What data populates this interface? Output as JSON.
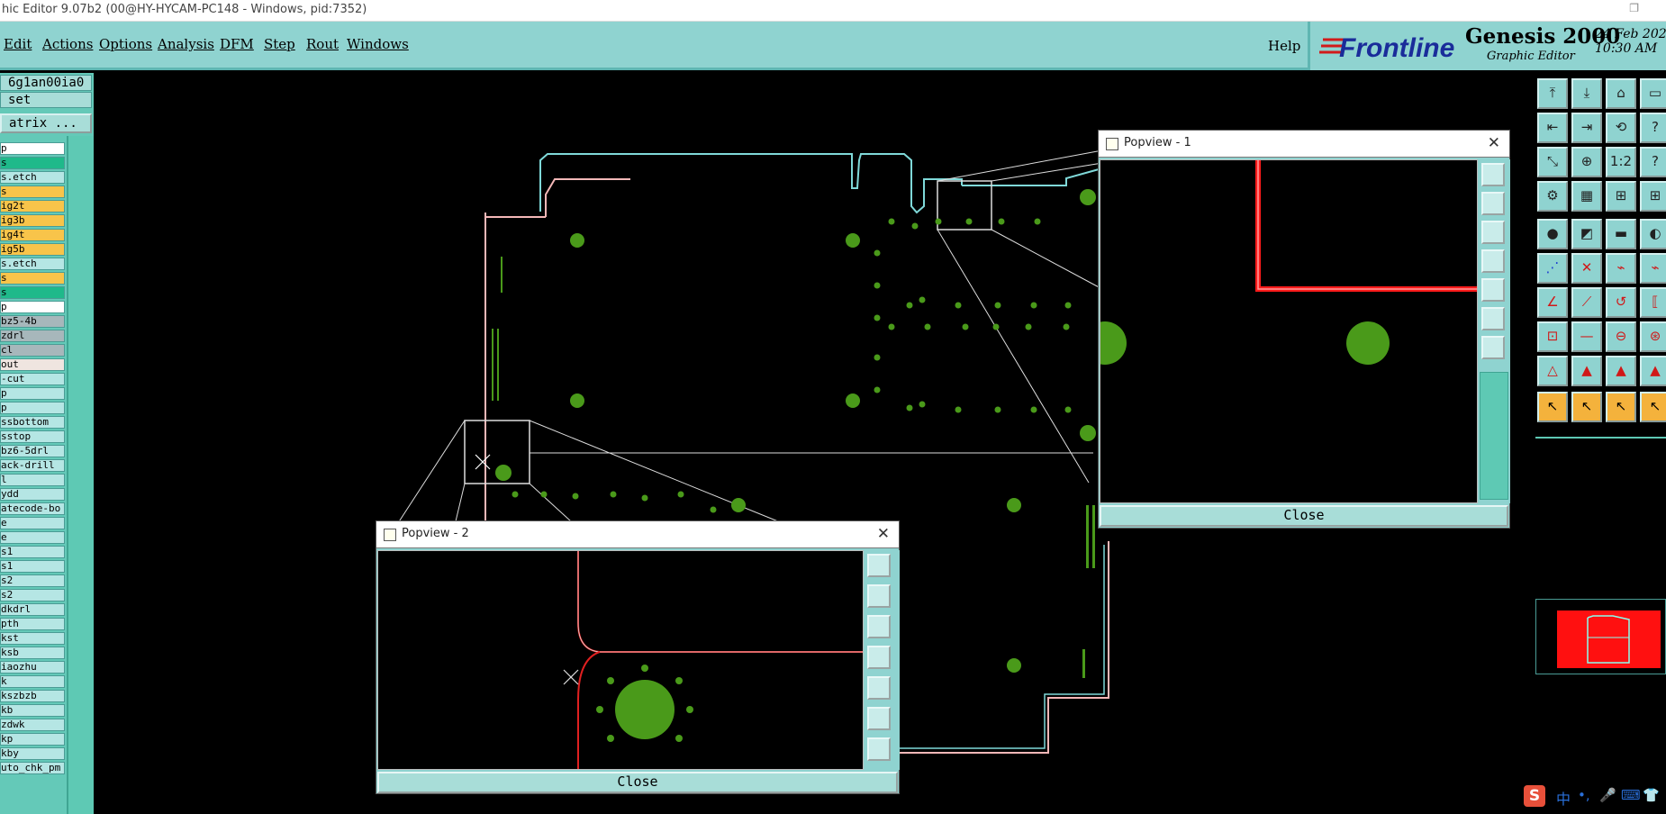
{
  "window": {
    "title": "hic Editor 9.07b2 (00@HY-HYCAM-PC148 - Windows, pid:7352)"
  },
  "menu": {
    "items": [
      {
        "label": "Edit"
      },
      {
        "label": "Actions"
      },
      {
        "label": "Options"
      },
      {
        "label": "Analysis"
      },
      {
        "label": "DFM"
      },
      {
        "label": "Step"
      },
      {
        "label": "Rout"
      },
      {
        "label": "Windows"
      }
    ],
    "help": "Help"
  },
  "brand": {
    "logo_text": "Frontline",
    "product": "Genesis 2000",
    "subtitle": "Graphic Editor",
    "date": "24 Feb 202",
    "time": "10:30 AM"
  },
  "left_panel": {
    "job": "6g1an00ia0",
    "step": "set",
    "matrix_button": "atrix ...",
    "layers": [
      {
        "label": "p",
        "color": "white"
      },
      {
        "label": "s",
        "color": "green"
      },
      {
        "label": "s.etch",
        "color": "teal"
      },
      {
        "label": "s",
        "color": "orange"
      },
      {
        "label": "ig2t",
        "color": "orange"
      },
      {
        "label": "ig3b",
        "color": "orange"
      },
      {
        "label": "ig4t",
        "color": "orange"
      },
      {
        "label": "ig5b",
        "color": "orange"
      },
      {
        "label": "s.etch",
        "color": "teal"
      },
      {
        "label": "s",
        "color": "orange"
      },
      {
        "label": "s",
        "color": "green"
      },
      {
        "label": "p",
        "color": "white"
      },
      {
        "label": "bz5-4b",
        "color": "grey"
      },
      {
        "label": "zdrl",
        "color": "grey"
      },
      {
        "label": "cl",
        "color": "grey"
      },
      {
        "label": "out",
        "color": "pink"
      },
      {
        "label": "-cut",
        "color": "teal"
      },
      {
        "label": "p",
        "color": "teal"
      },
      {
        "label": "p",
        "color": "teal"
      },
      {
        "label": "ssbottom",
        "color": "teal"
      },
      {
        "label": "sstop",
        "color": "teal"
      },
      {
        "label": "bz6-5drl",
        "color": "teal"
      },
      {
        "label": "ack-drill",
        "color": "teal"
      },
      {
        "label": "l",
        "color": "teal"
      },
      {
        "label": "ydd",
        "color": "teal"
      },
      {
        "label": "atecode-bo",
        "color": "teal"
      },
      {
        "label": "e",
        "color": "teal"
      },
      {
        "label": "e",
        "color": "teal"
      },
      {
        "label": "s1",
        "color": "teal"
      },
      {
        "label": "s1",
        "color": "teal"
      },
      {
        "label": "s2",
        "color": "teal"
      },
      {
        "label": "s2",
        "color": "teal"
      },
      {
        "label": "dkdrl",
        "color": "teal"
      },
      {
        "label": "pth",
        "color": "teal"
      },
      {
        "label": "kst",
        "color": "teal"
      },
      {
        "label": "ksb",
        "color": "teal"
      },
      {
        "label": "iaozhu",
        "color": "teal"
      },
      {
        "label": "k",
        "color": "teal"
      },
      {
        "label": "kszbzb",
        "color": "teal"
      },
      {
        "label": "kb",
        "color": "teal"
      },
      {
        "label": "zdwk",
        "color": "teal"
      },
      {
        "label": "kp",
        "color": "teal"
      },
      {
        "label": "kby",
        "color": "teal"
      },
      {
        "label": "uto_chk_pm",
        "color": "teal"
      }
    ]
  },
  "popview1": {
    "title": "Popview - 1",
    "close_label": "Close"
  },
  "popview2": {
    "title": "Popview - 2",
    "close_label": "Close"
  },
  "colors": {
    "panel": "#8fd3d0",
    "pad_green": "#4a9a1a",
    "outline_pink": "#f4b8b8",
    "outline_cyan": "#7fd9d9",
    "outline_red": "#e02020",
    "highlight_red": "#ff1a1a"
  },
  "ime": {
    "indicator": "中"
  }
}
